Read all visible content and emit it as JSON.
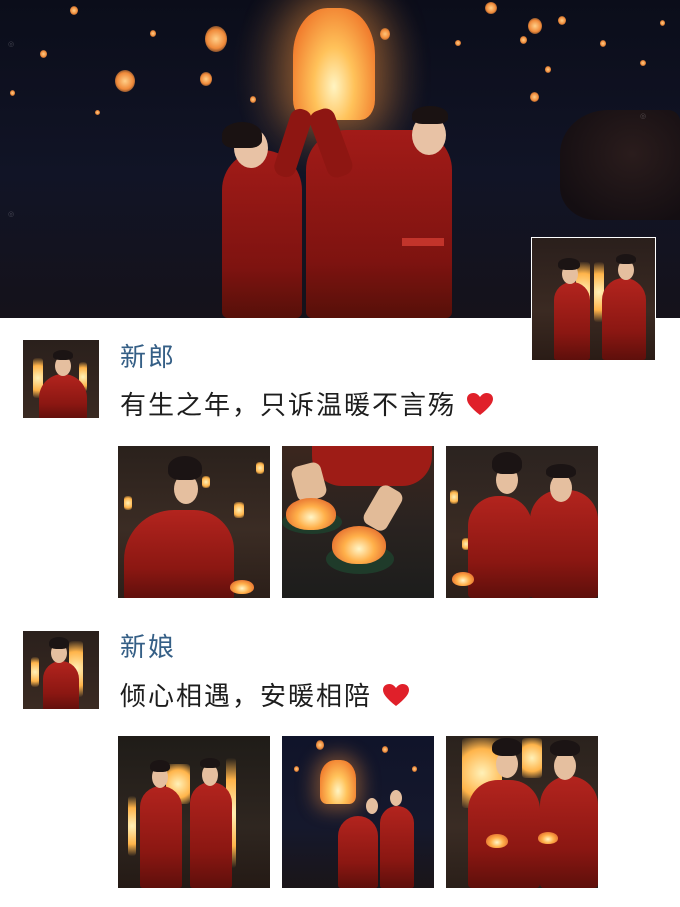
{
  "post_groom": {
    "name": "新郎",
    "message": "有生之年，只诉温暖不言殇",
    "heart_icon": "red-heart-icon"
  },
  "post_bride": {
    "name": "新娘",
    "message": "倾心相遇，安暖相陪",
    "heart_icon": "red-heart-icon"
  },
  "colors": {
    "name_color": "#355f86",
    "text_color": "#1d1d1d",
    "heart_color": "#e0202a",
    "robe_red": "#a21b18"
  }
}
